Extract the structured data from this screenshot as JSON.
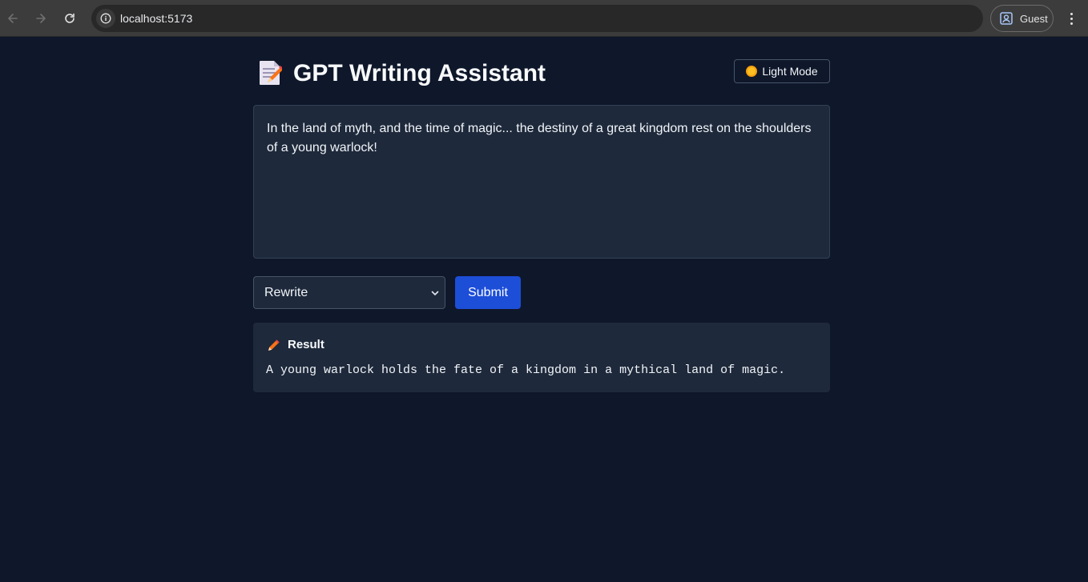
{
  "browser": {
    "url": "localhost:5173",
    "profile_label": "Guest",
    "back_icon": "arrow-left-icon",
    "forward_icon": "arrow-right-icon",
    "reload_icon": "reload-icon",
    "site_info_icon": "info-icon",
    "menu_icon": "more-vert-icon"
  },
  "app": {
    "title": "GPT Writing Assistant",
    "title_icon": "memo-icon",
    "theme_toggle": {
      "label": "Light Mode",
      "icon": "sun-icon"
    },
    "editor": {
      "value": "In the land of myth, and the time of magic... the destiny of a great kingdom rest on the shoulders of a young warlock!"
    },
    "mode_select": {
      "selected": "Rewrite"
    },
    "submit_label": "Submit",
    "result": {
      "icon": "pencil-icon",
      "label": "Result",
      "text": "A young warlock holds the fate of a kingdom in a mythical land of magic."
    }
  },
  "colors": {
    "background": "#0f172a",
    "card": "#1e293b",
    "accent": "#1d4ed8",
    "text": "#f1f5f9"
  }
}
